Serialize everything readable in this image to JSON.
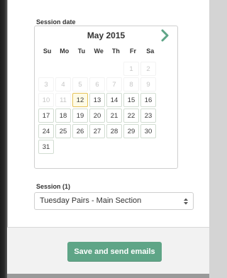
{
  "session_date": {
    "label": "Session date",
    "calendar": {
      "month_title": "May 2015",
      "next_icon": "chevron-right-icon",
      "weekdays": [
        "Su",
        "Mo",
        "Tu",
        "We",
        "Th",
        "Fr",
        "Sa"
      ],
      "weeks": [
        [
          {
            "t": "",
            "s": "empty"
          },
          {
            "t": "",
            "s": "empty"
          },
          {
            "t": "",
            "s": "empty"
          },
          {
            "t": "",
            "s": "empty"
          },
          {
            "t": "",
            "s": "empty"
          },
          {
            "t": "1",
            "s": "disabled"
          },
          {
            "t": "2",
            "s": "disabled"
          }
        ],
        [
          {
            "t": "3",
            "s": "disabled"
          },
          {
            "t": "4",
            "s": "disabled"
          },
          {
            "t": "5",
            "s": "disabled"
          },
          {
            "t": "6",
            "s": "disabled"
          },
          {
            "t": "7",
            "s": "disabled"
          },
          {
            "t": "8",
            "s": "disabled"
          },
          {
            "t": "9",
            "s": "disabled"
          }
        ],
        [
          {
            "t": "10",
            "s": "disabled"
          },
          {
            "t": "11",
            "s": "disabled"
          },
          {
            "t": "12",
            "s": "today"
          },
          {
            "t": "13",
            "s": "active"
          },
          {
            "t": "14",
            "s": "active"
          },
          {
            "t": "15",
            "s": "active"
          },
          {
            "t": "16",
            "s": "active"
          }
        ],
        [
          {
            "t": "17",
            "s": "active"
          },
          {
            "t": "18",
            "s": "active"
          },
          {
            "t": "19",
            "s": "active"
          },
          {
            "t": "20",
            "s": "active"
          },
          {
            "t": "21",
            "s": "active"
          },
          {
            "t": "22",
            "s": "active"
          },
          {
            "t": "23",
            "s": "active"
          }
        ],
        [
          {
            "t": "24",
            "s": "active"
          },
          {
            "t": "25",
            "s": "active"
          },
          {
            "t": "26",
            "s": "active"
          },
          {
            "t": "27",
            "s": "active"
          },
          {
            "t": "28",
            "s": "active"
          },
          {
            "t": "29",
            "s": "active"
          },
          {
            "t": "30",
            "s": "active"
          }
        ],
        [
          {
            "t": "31",
            "s": "active"
          }
        ]
      ]
    }
  },
  "session": {
    "label": "Session (1)",
    "selected": "Tuesday Pairs - Main Section",
    "icon": "select-arrows-icon"
  },
  "footer": {
    "save_label": "Save and send emails"
  },
  "colors": {
    "accent": "#5fa587",
    "chevron": "#5fa587",
    "today_border": "#e6c35a"
  }
}
